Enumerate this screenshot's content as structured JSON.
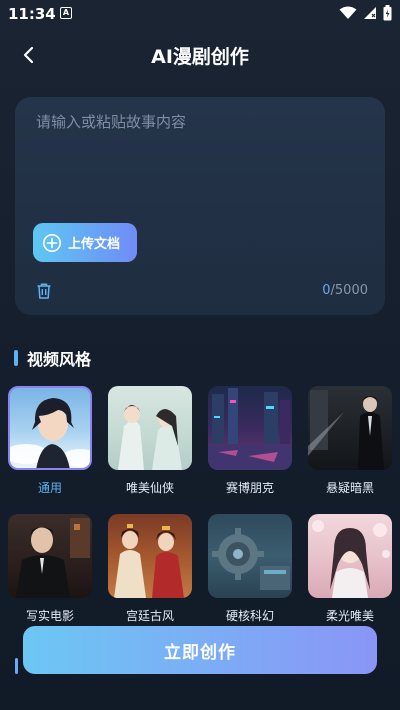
{
  "status_bar": {
    "time": "11:34",
    "app_badge": "A",
    "icons": [
      "wifi-icon",
      "signal-icon",
      "battery-icon"
    ]
  },
  "header": {
    "title": "AI漫剧创作",
    "back_icon": "chevron-left-icon"
  },
  "story_input": {
    "placeholder": "请输入或粘贴故事内容",
    "value": ""
  },
  "upload_button": {
    "label": "上传文档",
    "icon": "plus-circle-icon"
  },
  "counter": {
    "current": "0",
    "max": "/5000"
  },
  "style_section": {
    "title": "视频风格",
    "items": [
      {
        "label": "通用",
        "selected": true
      },
      {
        "label": "唯美仙侠",
        "selected": false
      },
      {
        "label": "赛博朋克",
        "selected": false
      },
      {
        "label": "悬疑暗黑",
        "selected": false
      },
      {
        "label": "写实电影",
        "selected": false
      },
      {
        "label": "宫廷古风",
        "selected": false
      },
      {
        "label": "硬核科幻",
        "selected": false
      },
      {
        "label": "柔光唯美",
        "selected": false
      }
    ]
  },
  "create_button": {
    "label": "立即创作"
  },
  "colors": {
    "background": "#151f2d",
    "card": "#22314a",
    "accent_blue": "#5fb2f3",
    "accent_purple": "#8a83f0"
  }
}
